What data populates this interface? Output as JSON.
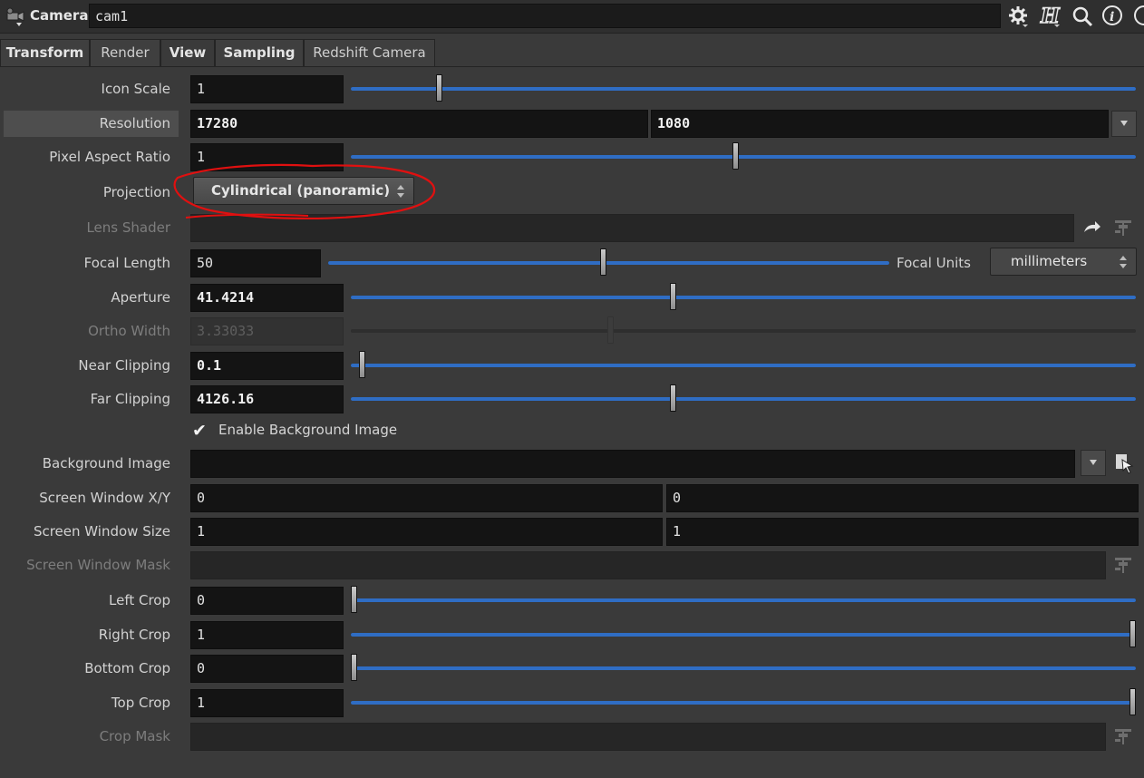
{
  "header": {
    "node_type": "Camera",
    "node_name": "cam1"
  },
  "tabs": [
    {
      "label": "Transform"
    },
    {
      "label": "Render"
    },
    {
      "label": "View"
    },
    {
      "label": "Sampling"
    },
    {
      "label": "Redshift Camera"
    }
  ],
  "active_tab": "View",
  "params": {
    "icon_scale": {
      "label": "Icon Scale",
      "value": "1",
      "slider_fraction": 0.11
    },
    "resolution": {
      "label": "Resolution",
      "width": "17280",
      "height": "1080"
    },
    "pixel_aspect": {
      "label": "Pixel Aspect Ratio",
      "value": "1",
      "slider_fraction": 0.49
    },
    "projection": {
      "label": "Projection",
      "value": "Cylindrical (panoramic)"
    },
    "lens_shader": {
      "label": "Lens Shader"
    },
    "focal_length": {
      "label": "Focal Length",
      "value": "50",
      "slider_fraction": 0.49
    },
    "focal_units": {
      "label": "Focal Units",
      "value": "millimeters"
    },
    "aperture": {
      "label": "Aperture",
      "value": "41.4214",
      "slider_fraction": 0.41
    },
    "ortho_width": {
      "label": "Ortho Width",
      "value": "3.33033",
      "slider_fraction": 0.33
    },
    "near_clipping": {
      "label": "Near Clipping",
      "value": "0.1",
      "slider_fraction": 0.01
    },
    "far_clipping": {
      "label": "Far Clipping",
      "value": "4126.16",
      "slider_fraction": 0.41
    },
    "enable_bg": {
      "label": "Enable Background Image",
      "checked": true
    },
    "background_image": {
      "label": "Background Image",
      "value": ""
    },
    "screen_window_xy": {
      "label": "Screen Window X/Y",
      "x": "0",
      "y": "0"
    },
    "screen_window_size": {
      "label": "Screen Window Size",
      "x": "1",
      "y": "1"
    },
    "screen_window_mask": {
      "label": "Screen Window Mask"
    },
    "left_crop": {
      "label": "Left Crop",
      "value": "0",
      "slider_fraction": 0.0
    },
    "right_crop": {
      "label": "Right Crop",
      "value": "1",
      "slider_fraction": 1.0
    },
    "bottom_crop": {
      "label": "Bottom Crop",
      "value": "0",
      "slider_fraction": 0.0
    },
    "top_crop": {
      "label": "Top Crop",
      "value": "1",
      "slider_fraction": 1.0
    },
    "crop_mask": {
      "label": "Crop Mask"
    }
  },
  "icons": [
    "camera-node-icon",
    "gear-icon",
    "houdini-help-icon",
    "search-icon",
    "info-icon",
    "dropdown-arrow-icon",
    "jump-arrow-icon",
    "node-chooser-icon",
    "file-chooser-icon"
  ],
  "colors": {
    "slider_fill": "#2f6dc4",
    "annotation": "#e01010",
    "field_bg": "#141414",
    "panel_bg": "#3a3a3a"
  }
}
